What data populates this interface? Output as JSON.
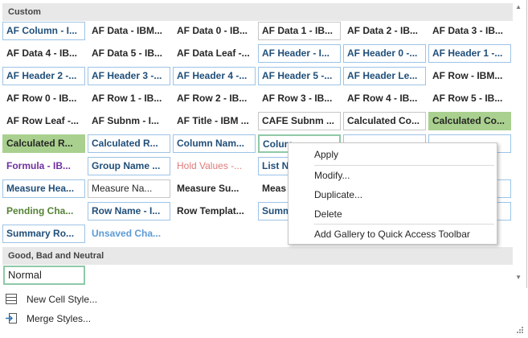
{
  "sections": {
    "custom": "Custom",
    "good_bad_neutral": "Good, Bad and Neutral"
  },
  "styles": [
    [
      "AF Column - I...",
      "AF Data - IBM...",
      "AF Data 0 - IB...",
      "AF Data 1 - IB...",
      "AF Data 2 - IB...",
      "AF Data 3 - IB..."
    ],
    [
      "AF Data 4 - IB...",
      "AF Data 5 - IB...",
      "AF Data Leaf -...",
      "AF Header - I...",
      "AF Header 0 -...",
      "AF Header 1 -..."
    ],
    [
      "AF Header 2 -...",
      "AF Header 3 -...",
      "AF Header 4 -...",
      "AF Header 5 -...",
      "AF Header Le...",
      "AF Row - IBM..."
    ],
    [
      "AF Row 0 - IB...",
      "AF Row 1 - IB...",
      "AF Row 2 - IB...",
      "AF Row 3 - IB...",
      "AF Row 4 - IB...",
      "AF Row 5 - IB..."
    ],
    [
      "AF Row Leaf -...",
      "AF Subnm - I...",
      "AF Title - IBM ...",
      "CAFE Subnm ...",
      "Calculated Co...",
      "Calculated Co..."
    ],
    [
      "Calculated R...",
      "Calculated R...",
      "Column Nam...",
      "Colum",
      "",
      ""
    ],
    [
      "Formula - IB...",
      "Group Name ...",
      "Hold Values -...",
      "List N",
      "",
      ""
    ],
    [
      "Measure Hea...",
      "Measure Na...",
      "Measure Su...",
      "Meas",
      "",
      ""
    ],
    [
      "Pending Cha...",
      "Row Name - I...",
      "Row Templat...",
      "Summ",
      "",
      ""
    ],
    [
      "Summary Ro...",
      "Unsaved Cha...",
      "",
      "",
      "",
      ""
    ]
  ],
  "normal_style": "Normal",
  "footer": {
    "new_style": "New Cell Style...",
    "merge_styles": "Merge Styles..."
  },
  "context_menu": {
    "apply": "Apply",
    "modify": "Modify...",
    "duplicate": "Duplicate...",
    "delete": "Delete",
    "add_to_qat": "Add Gallery to Quick Access Toolbar"
  },
  "colors": {
    "header_bg": "#e8e8e8",
    "calculated_fill": "#a9d08e",
    "blue_text": "#1f4e79",
    "selection_border": "#8fc9a8"
  }
}
